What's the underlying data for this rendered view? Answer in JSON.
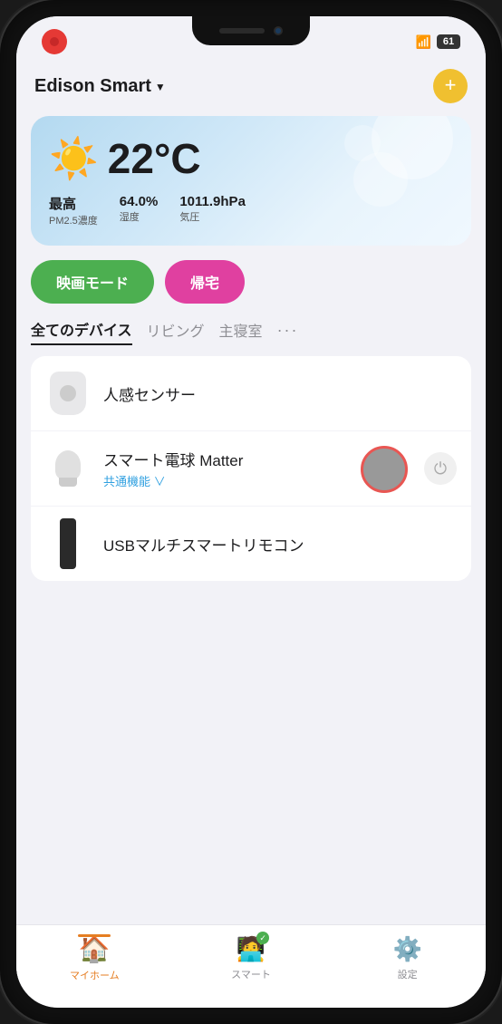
{
  "app": {
    "title": "Edison Smart",
    "chevron": "▼"
  },
  "status_bar": {
    "battery": "61",
    "wifi": "📶"
  },
  "weather": {
    "temperature": "22°C",
    "sun_emoji": "☀️",
    "stats": [
      {
        "value": "最高",
        "label": "PM2.5濃度"
      },
      {
        "value": "64.0%",
        "label": "湿度"
      },
      {
        "value": "1011.9hPa",
        "label": "気圧"
      }
    ]
  },
  "modes": [
    {
      "key": "movie",
      "label": "映画モード",
      "color": "green"
    },
    {
      "key": "home",
      "label": "帰宅",
      "color": "pink"
    }
  ],
  "tabs": [
    {
      "key": "all",
      "label": "全てのデバイス",
      "active": true
    },
    {
      "key": "living",
      "label": "リビング",
      "active": false
    },
    {
      "key": "bedroom",
      "label": "主寝室",
      "active": false
    },
    {
      "key": "more",
      "label": "···",
      "active": false
    }
  ],
  "devices": [
    {
      "key": "sensor",
      "name": "人感センサー",
      "sub": "",
      "has_power": false,
      "has_cursor": false
    },
    {
      "key": "bulb",
      "name": "スマート電球 Matter",
      "sub": "共通機能 ∨",
      "has_power": true,
      "has_cursor": true
    },
    {
      "key": "usb",
      "name": "USBマルチスマートリモコン",
      "sub": "",
      "has_power": false,
      "has_cursor": false
    }
  ],
  "bottom_nav": [
    {
      "key": "home",
      "label": "マイホーム",
      "active": true
    },
    {
      "key": "smart",
      "label": "スマート",
      "active": false
    },
    {
      "key": "settings",
      "label": "設定",
      "active": false
    }
  ]
}
